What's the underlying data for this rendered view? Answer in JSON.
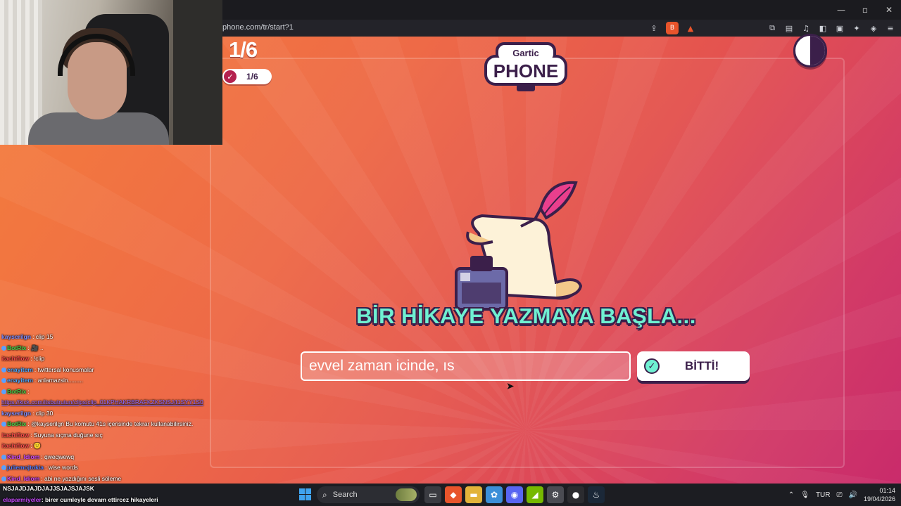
{
  "browser": {
    "url": "phone.com/tr/start?1",
    "window_controls": [
      "—",
      "▫",
      "✕"
    ],
    "shield_badge": "▲"
  },
  "game": {
    "round": "1/6",
    "done_count": "1/6",
    "heading": "BİR HİKAYE YAZMAYA BAŞLA...",
    "input_value": "evvel zaman icinde, ıs",
    "done_button": "BİTTİ!",
    "logo_top": "Gartic",
    "logo_bottom": "PHONE",
    "colors": {
      "accent": "#6ff0d2",
      "ink": "#3b1f4a",
      "bg_start": "#f47d3c",
      "bg_end": "#c92b6b"
    }
  },
  "chat": [
    {
      "user": "kayserilgn",
      "text": ": clip 15",
      "color": "#7b8cff"
    },
    {
      "user": "BotRix",
      "text": ": 🎥 ..",
      "color": "#3fd24a"
    },
    {
      "user": "itachiflow",
      "text": ": !clip",
      "color": "#ff4a4a"
    },
    {
      "user": "enayitem",
      "text": ": twittersal konusmalar",
      "color": "#4aa8ff"
    },
    {
      "user": "enayitem",
      "text": ": anlamazsin.........",
      "color": "#4aa8ff"
    },
    {
      "user": "BotRix",
      "text": ":",
      "color": "#3fd24a"
    },
    {
      "user": "",
      "text": "https://kick.com/itsbutrutun/clips/clip_01KPHAKRBRAFKZKSNSJ41SYY1S0",
      "color": "#8a6bff"
    },
    {
      "user": "kayserilgn",
      "text": ": clip 30",
      "color": "#7b8cff"
    },
    {
      "user": "BotRix",
      "text": ": @kayserilgn Bu komutu 41s içerisinde tekrar kullanabilirsiniz.",
      "color": "#3fd24a"
    },
    {
      "user": "itachiflow",
      "text": ": Suyuna sıçma duğune sıç",
      "color": "#ff4a4a"
    },
    {
      "user": "itachiflow",
      "text": ": 🙂",
      "color": "#ff4a4a"
    },
    {
      "user": "Kind_Idiom",
      "text": ": qweqwewq",
      "color": "#c94aff"
    },
    {
      "user": "juliemojtokia",
      "text": ": wise words",
      "color": "#4a7bff"
    },
    {
      "user": "Kind_Idiom",
      "text": ": abi ne yazdığını sesli söleme",
      "color": "#c94aff"
    }
  ],
  "chat_overlay": {
    "line1": "NSJAJDJAJDJAJJSJAJSJAJSK",
    "line2": "birer cumleyle devam ettircez hikayeleri",
    "line2_user": "elaparmiyeler"
  },
  "taskbar": {
    "search_placeholder": "Search",
    "language": "TUR",
    "time": "01:14",
    "date": "19/04/2026"
  }
}
